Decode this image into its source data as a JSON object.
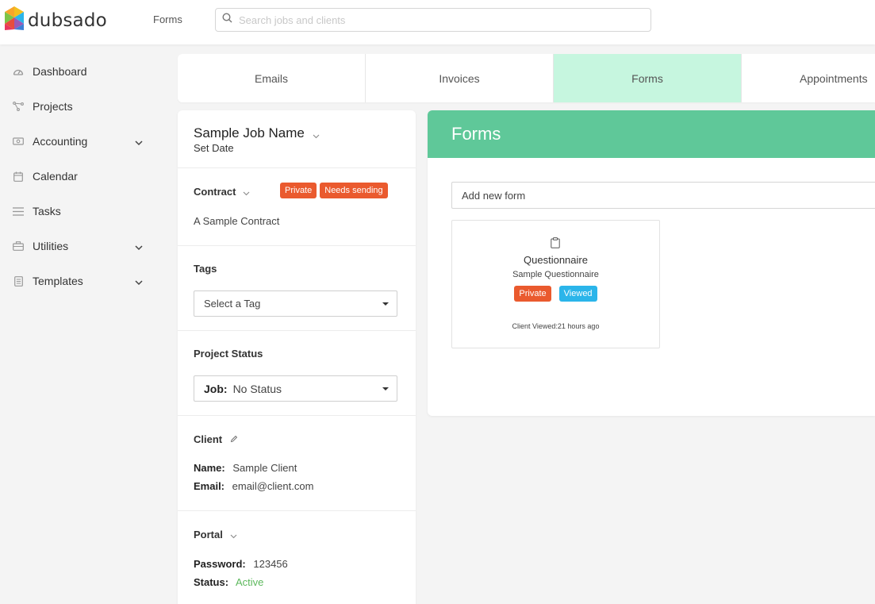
{
  "app": {
    "logo_text": "dubsado"
  },
  "header": {
    "breadcrumb": "Forms",
    "search_placeholder": "Search jobs and clients"
  },
  "sidebar": {
    "items": [
      {
        "label": "Dashboard",
        "icon": "dashboard-icon",
        "expandable": false
      },
      {
        "label": "Projects",
        "icon": "projects-icon",
        "expandable": false
      },
      {
        "label": "Accounting",
        "icon": "accounting-icon",
        "expandable": true
      },
      {
        "label": "Calendar",
        "icon": "calendar-icon",
        "expandable": false
      },
      {
        "label": "Tasks",
        "icon": "tasks-icon",
        "expandable": false
      },
      {
        "label": "Utilities",
        "icon": "utilities-icon",
        "expandable": true
      },
      {
        "label": "Templates",
        "icon": "templates-icon",
        "expandable": true
      }
    ]
  },
  "tabs": [
    {
      "label": "Emails",
      "active": false
    },
    {
      "label": "Invoices",
      "active": false
    },
    {
      "label": "Forms",
      "active": true
    },
    {
      "label": "Appointments",
      "active": false
    }
  ],
  "job": {
    "name": "Sample Job Name",
    "date_label": "Set Date",
    "contract": {
      "title": "Contract",
      "badge_private": "Private",
      "badge_status": "Needs sending",
      "name": "A Sample Contract"
    },
    "tags": {
      "title": "Tags",
      "select_value": "Select a Tag"
    },
    "project_status": {
      "title": "Project Status",
      "prefix": "Job:",
      "value": "No Status"
    },
    "client": {
      "title": "Client",
      "name_label": "Name:",
      "name_value": "Sample Client",
      "email_label": "Email:",
      "email_value": "email@client.com"
    },
    "portal": {
      "title": "Portal",
      "password_label": "Password:",
      "password_value": "123456",
      "status_label": "Status:",
      "status_value": "Active"
    }
  },
  "forms": {
    "title": "Forms",
    "add_label": "Add new form",
    "card": {
      "title": "Questionnaire",
      "subtitle": "Sample Questionnaire",
      "badge_private": "Private",
      "badge_viewed": "Viewed",
      "viewed_label": "Client Viewed:",
      "viewed_value": "21 hours ago"
    }
  },
  "colors": {
    "accent_green": "#5fc899",
    "active_tab_bg": "#c6f6df",
    "badge_orange": "#ea5a2e",
    "badge_blue": "#2bb5ea",
    "status_active": "#5cb85c"
  }
}
